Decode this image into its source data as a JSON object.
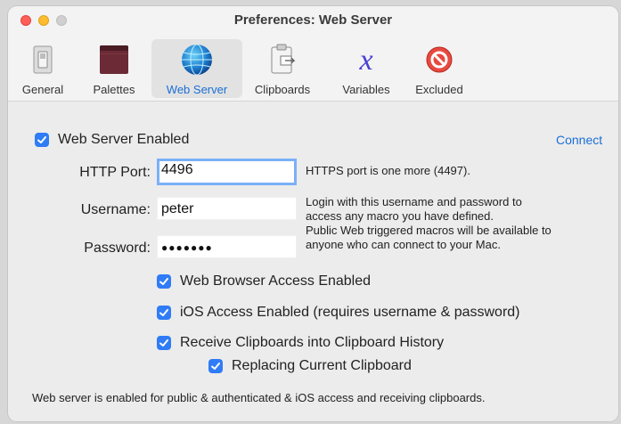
{
  "window": {
    "title": "Preferences: Web Server"
  },
  "tabs": [
    {
      "label": "General",
      "icon": "switch-icon"
    },
    {
      "label": "Palettes",
      "icon": "palette-icon"
    },
    {
      "label": "Web Server",
      "icon": "globe-icon",
      "active": true
    },
    {
      "label": "Clipboards",
      "icon": "clipboard-icon"
    },
    {
      "label": "Variables",
      "icon": "variable-x-icon"
    },
    {
      "label": "Excluded",
      "icon": "prohibited-icon"
    }
  ],
  "web_server": {
    "enabled_label": "Web Server Enabled",
    "enabled": true,
    "connect_label": "Connect",
    "http_port_label": "HTTP Port:",
    "http_port_value": "4496",
    "https_note": "HTTPS port is one more (4497).",
    "username_label": "Username:",
    "username_value": "peter",
    "password_label": "Password:",
    "password_value": "●●●●●●●",
    "login_note_1": "Login with this username and password to",
    "login_note_2": "access any macro you have defined.",
    "login_note_3": "Public Web triggered macros will be available to",
    "login_note_4": "anyone who can connect to your Mac.",
    "options": [
      {
        "label": "Web Browser Access Enabled",
        "checked": true
      },
      {
        "label": "iOS Access Enabled (requires username & password)",
        "checked": true
      },
      {
        "label": "Receive Clipboards into Clipboard History",
        "checked": true
      },
      {
        "label": "Replacing Current Clipboard",
        "checked": true
      }
    ],
    "status": "Web server is enabled for public & authenticated & iOS access and receiving clipboards."
  },
  "colors": {
    "accent": "#2f7cf6",
    "link": "#1a6fd6",
    "focus_ring": "#7ab0f7"
  }
}
